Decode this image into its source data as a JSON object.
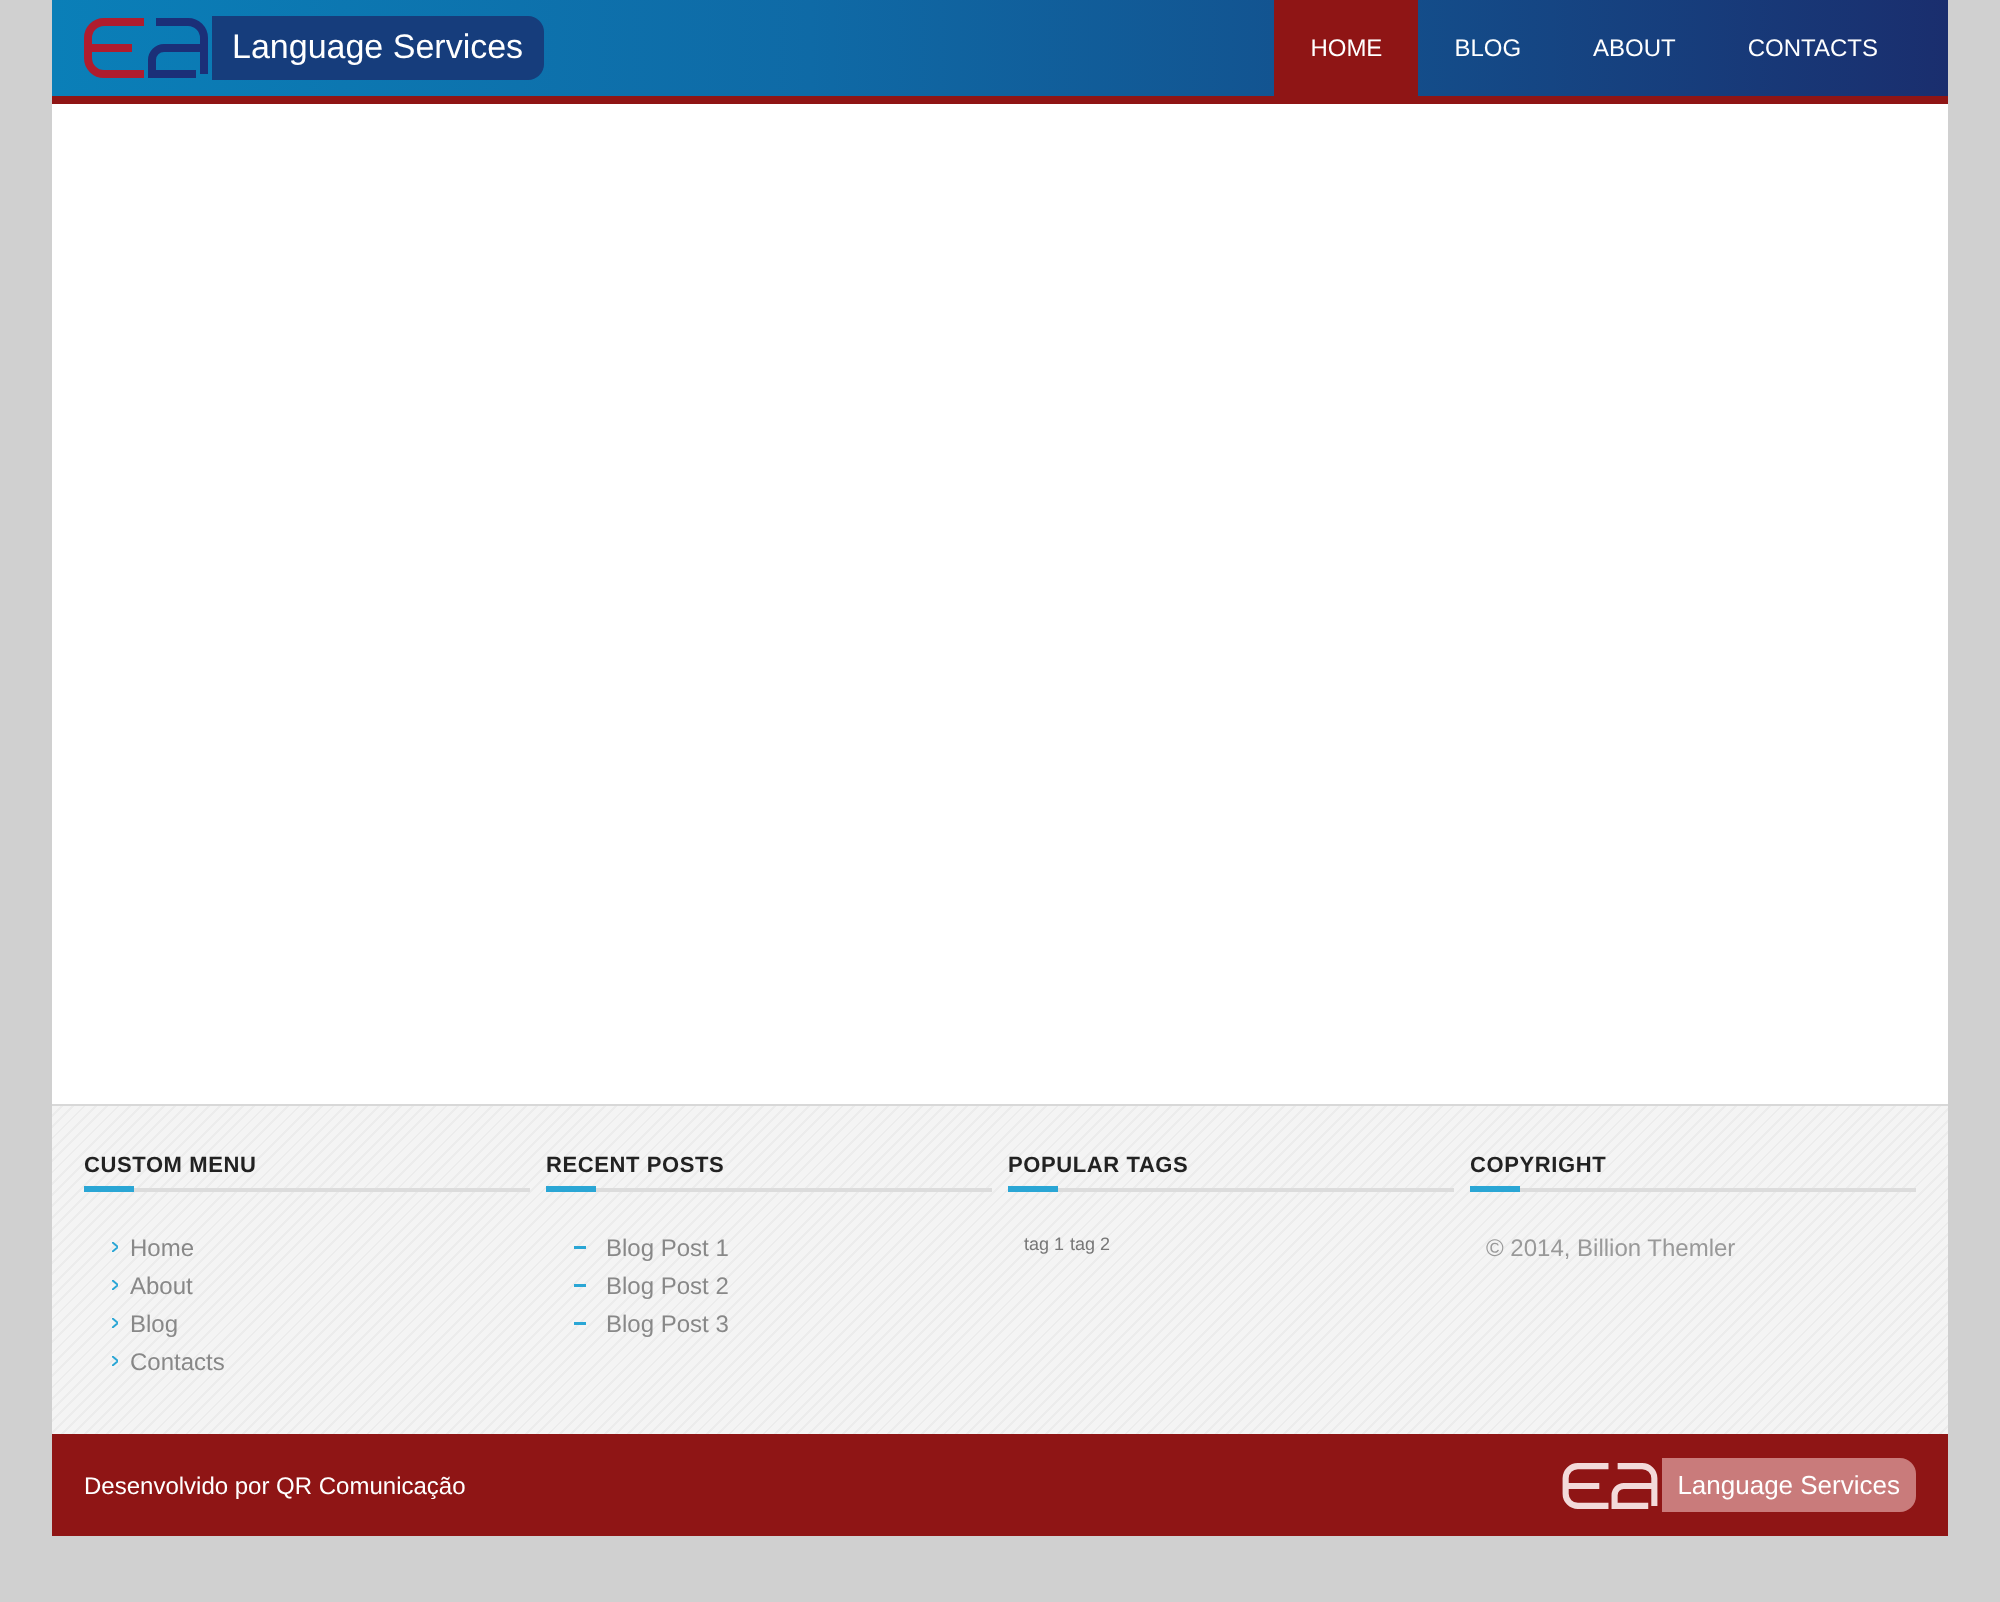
{
  "header": {
    "logo_text": "Language Services",
    "nav": [
      {
        "label": "HOME",
        "selected": true
      },
      {
        "label": "BLOG",
        "selected": false
      },
      {
        "label": "ABOUT",
        "selected": false
      },
      {
        "label": "CONTACTS",
        "selected": false
      }
    ]
  },
  "footer_widgets": [
    {
      "title": "CUSTOM MENU",
      "kind": "menu",
      "items": [
        "Home",
        "About",
        "Blog",
        "Contacts"
      ]
    },
    {
      "title": "RECENT POSTS",
      "kind": "posts",
      "items": [
        "Blog Post 1",
        "Blog Post 2",
        "Blog Post 3"
      ]
    },
    {
      "title": "POPULAR TAGS",
      "kind": "tags",
      "items": [
        "tag 1",
        "tag 2"
      ]
    },
    {
      "title": "COPYRIGHT",
      "kind": "text",
      "text": "© 2014, Billion Themler"
    }
  ],
  "bottom_bar": {
    "credit": "Desenvolvido por QR Comunicação",
    "logo_text": "Language Services"
  }
}
